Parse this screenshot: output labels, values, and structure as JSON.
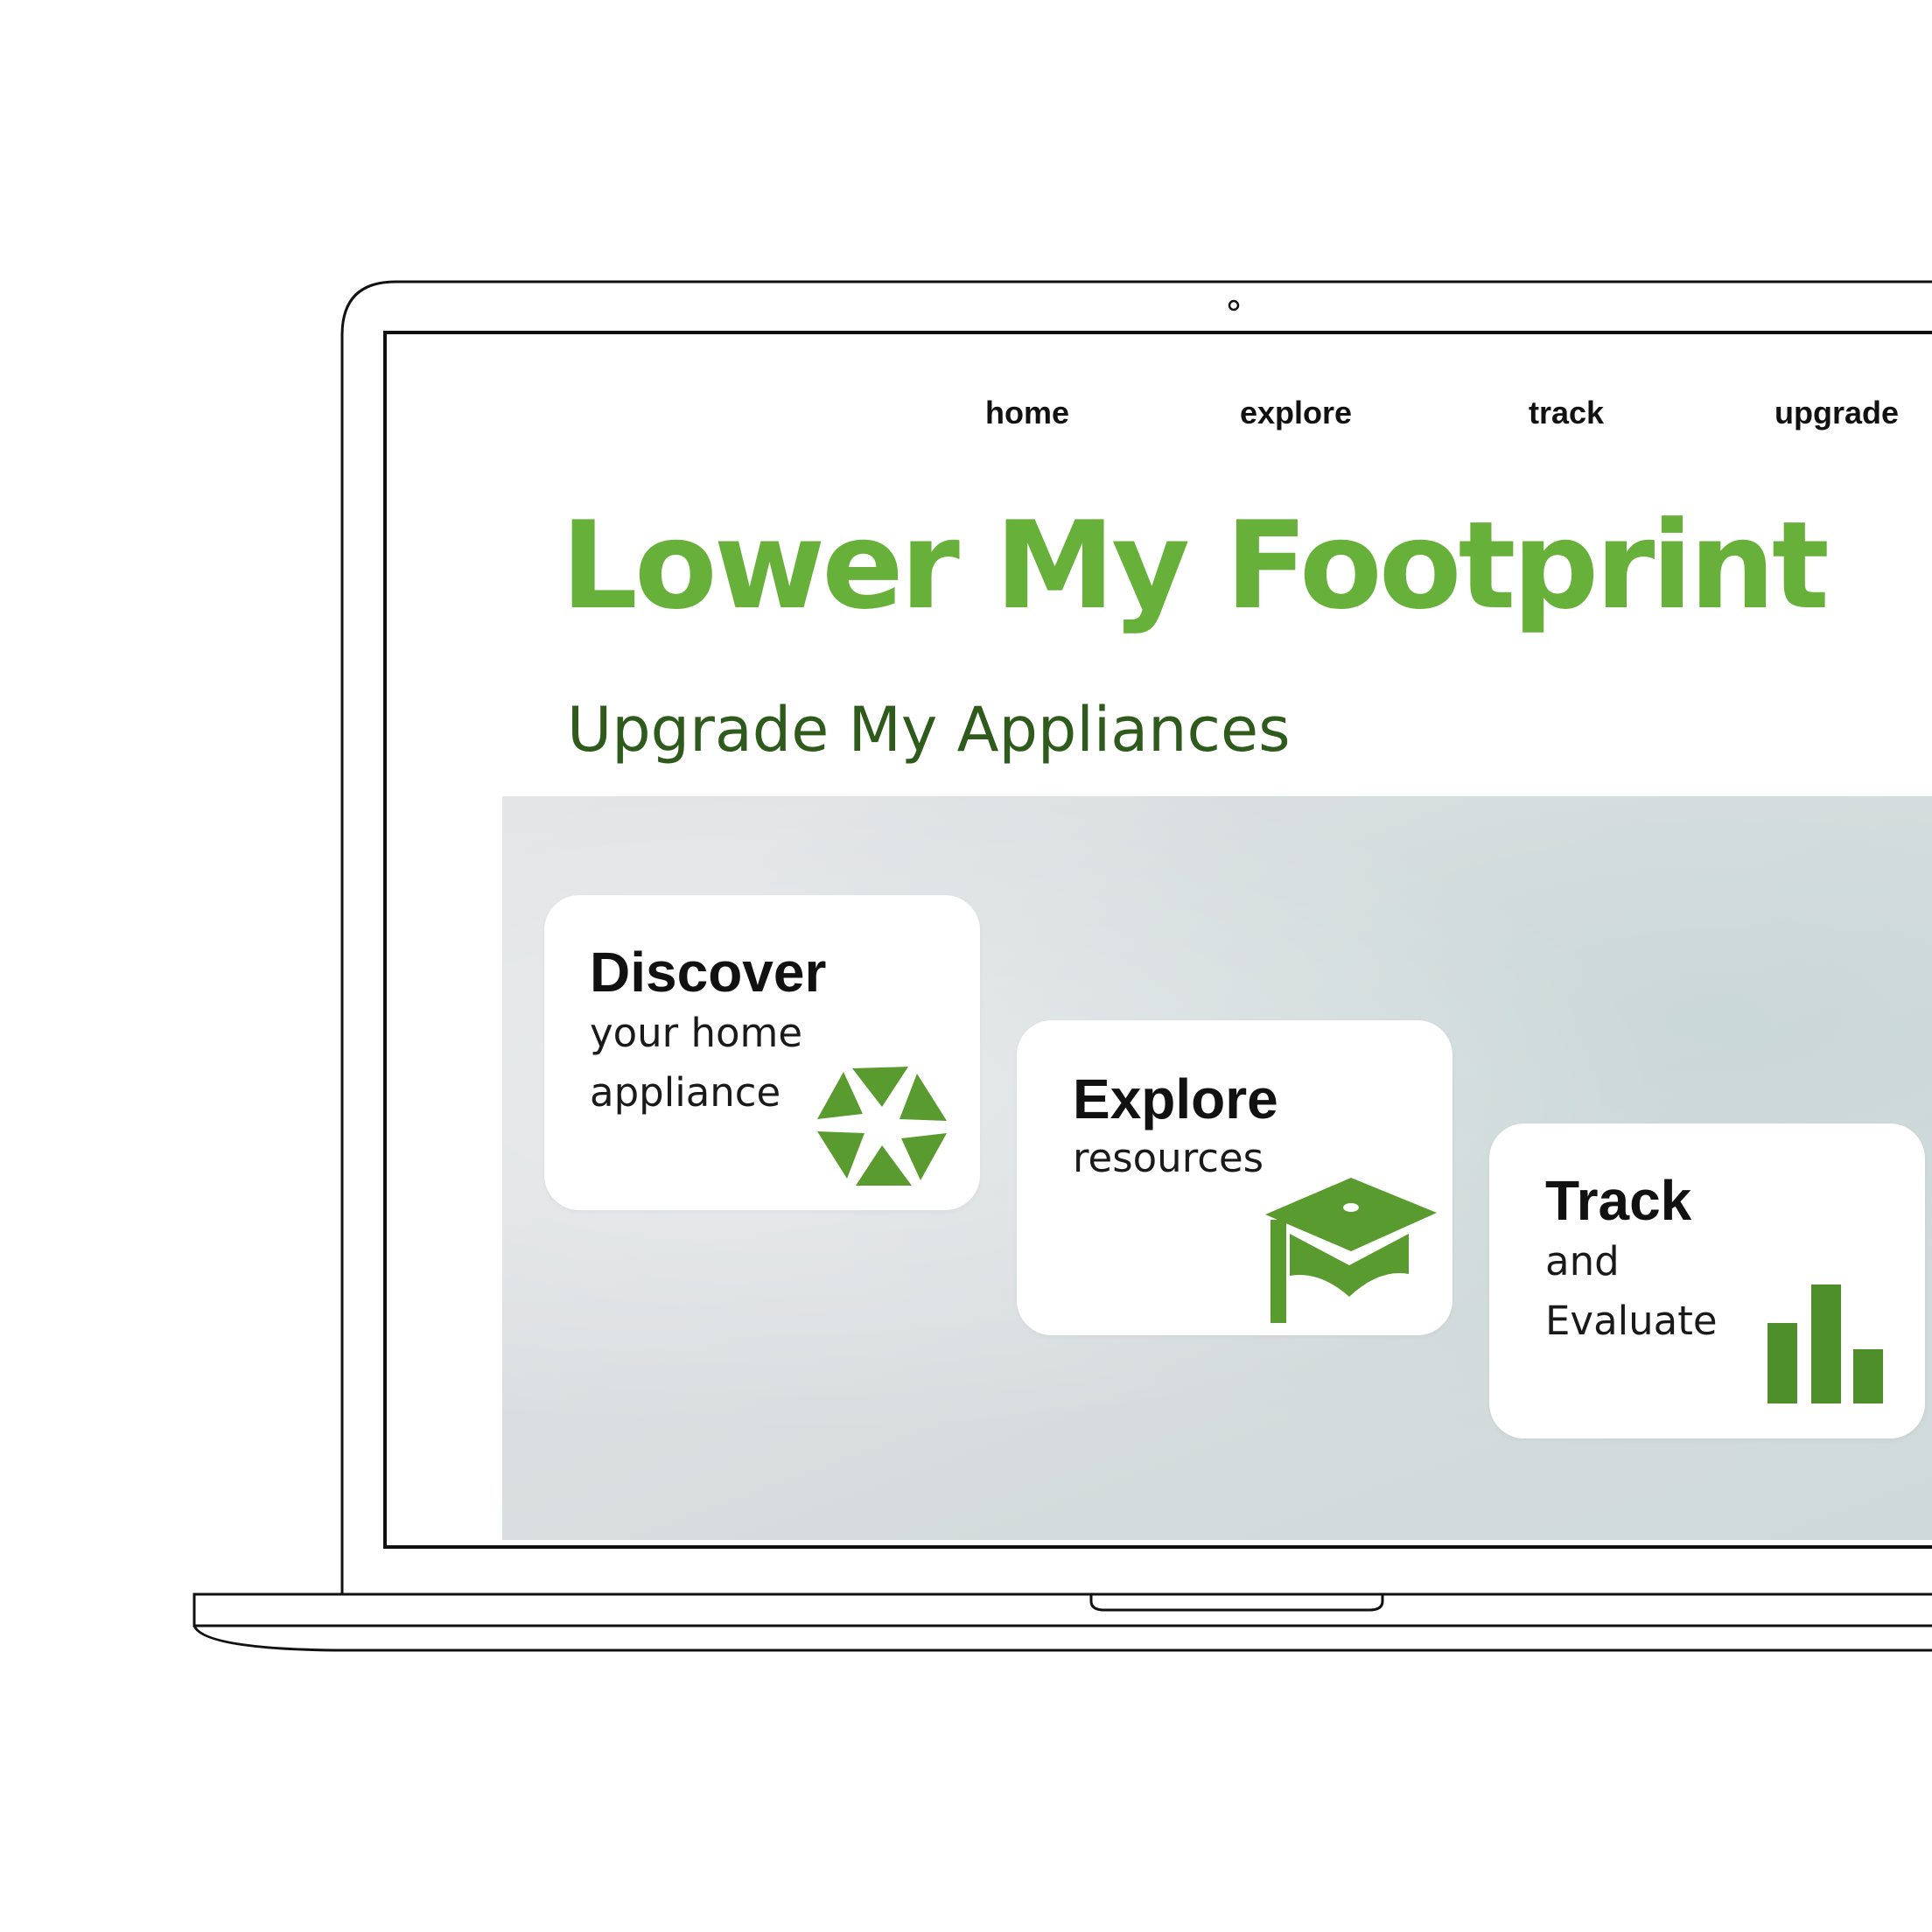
{
  "nav": {
    "items": [
      {
        "label": "home"
      },
      {
        "label": "explore"
      },
      {
        "label": "track"
      },
      {
        "label": "upgrade"
      }
    ]
  },
  "hero": {
    "title": "Lower My Footprint",
    "subtitle": "Upgrade My Appliances"
  },
  "cards": [
    {
      "title": "Discover",
      "lines": [
        "your home",
        "appliance"
      ],
      "icon": "aperture-icon"
    },
    {
      "title": "Explore",
      "lines": [
        "resources"
      ],
      "icon": "graduation-cap-icon"
    },
    {
      "title": "Track",
      "lines": [
        "and",
        "Evaluate"
      ],
      "icon": "bar-chart-icon"
    }
  ],
  "colors": {
    "brand_green": "#67b13b",
    "subtitle_green": "#2e5a1c",
    "icon_green": "#5a9b30",
    "bar_green": "#4f8f2b"
  }
}
